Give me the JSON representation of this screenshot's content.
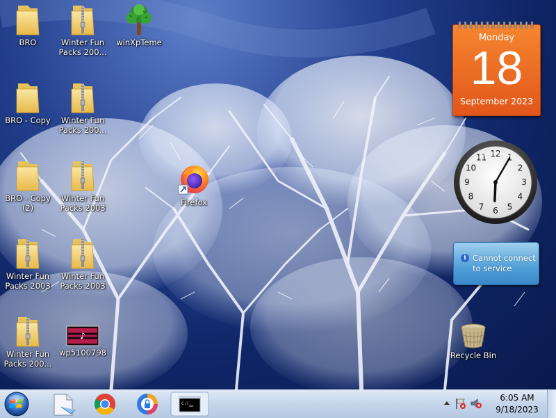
{
  "desktop_icons": [
    {
      "label": "BRO",
      "type": "folder"
    },
    {
      "label": "Winter Fun Packs 200...",
      "type": "zip-folder"
    },
    {
      "label": "winXpTeme",
      "type": "tree"
    },
    {
      "label": "BRO - Copy",
      "type": "folder"
    },
    {
      "label": "Winter Fun Packs 200...",
      "type": "zip-folder"
    },
    {
      "label": "BRO - Copy (2)",
      "type": "folder"
    },
    {
      "label": "Winter Fun Packs 2003",
      "type": "zip-folder"
    },
    {
      "label": "Firefox",
      "type": "firefox"
    },
    {
      "label": "Winter Fun Packs 2003",
      "type": "zip-folder"
    },
    {
      "label": "Winter Fun Packs 2003",
      "type": "zip-folder"
    },
    {
      "label": "Winter Fun Packs 200...",
      "type": "zip-folder"
    },
    {
      "label": "wp5100798",
      "type": "image-file"
    },
    {
      "label": "Recycle Bin",
      "type": "recycle-bin"
    }
  ],
  "calendar": {
    "day": "Monday",
    "date": "18",
    "month": "September 2023"
  },
  "clock": {
    "hour": 6,
    "minute": 5
  },
  "weather": {
    "message": "Cannot connect to service"
  },
  "taskbar": {
    "pinned": [
      "start-orb",
      "file-explorer",
      "chrome",
      "vpn-app",
      "command-prompt"
    ],
    "tray": {
      "time": "6:05 AM",
      "date": "9/18/2023"
    }
  },
  "colors": {
    "calendar": "#e86a24",
    "taskbar": "#c4d5ea"
  }
}
